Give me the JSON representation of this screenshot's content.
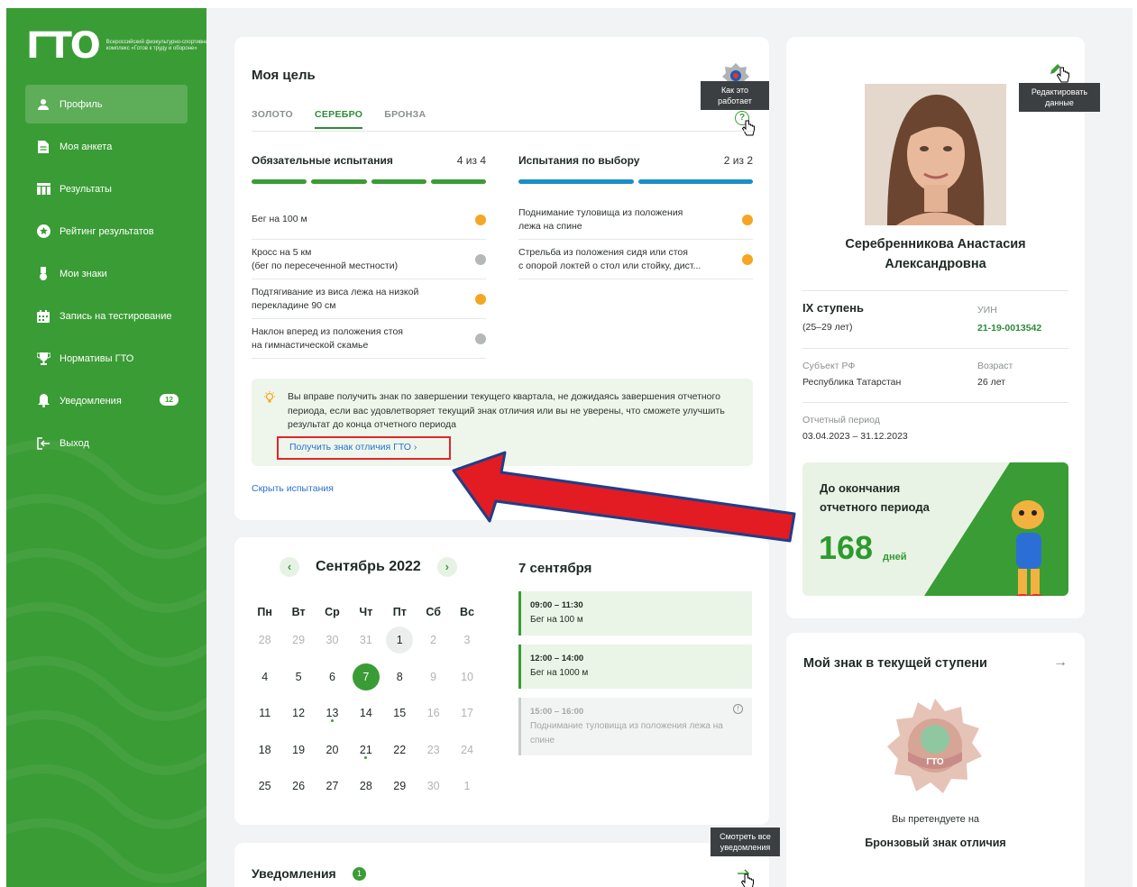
{
  "sidebar": {
    "logo_mark": "ГТО",
    "logo_text": "Всероссийский физкультурно-спортивный комплекс «Готов к труду и обороне»",
    "items": [
      {
        "label": "Профиль",
        "icon": "user-icon",
        "active": true
      },
      {
        "label": "Моя анкета",
        "icon": "document-icon"
      },
      {
        "label": "Результаты",
        "icon": "table-icon"
      },
      {
        "label": "Рейтинг результатов",
        "icon": "star-icon"
      },
      {
        "label": "Мои знаки",
        "icon": "medal-icon"
      },
      {
        "label": "Запись на тестирование",
        "icon": "calendar-icon"
      },
      {
        "label": "Нормативы ГТО",
        "icon": "trophy-icon"
      },
      {
        "label": "Уведомления",
        "icon": "bell-icon",
        "badge": "12"
      },
      {
        "label": "Выход",
        "icon": "logout-icon"
      }
    ]
  },
  "goal": {
    "title": "Моя цель",
    "tabs": [
      "ЗОЛОТО",
      "СЕРЕБРО",
      "БРОНЗА"
    ],
    "active_tab": "СЕРЕБРО",
    "help_tooltip": "Как это работает",
    "required": {
      "title": "Обязательные испытания",
      "count": "4 из 4",
      "tests": [
        {
          "name": "Бег на 100 м",
          "status": "orange"
        },
        {
          "name": "Кросс на 5 км",
          "name2": "(бег по пересеченной местности)",
          "status": "gray"
        },
        {
          "name": "Подтягивание из виса лежа на низкой",
          "name2": "перекладине 90 см",
          "status": "orange"
        },
        {
          "name": "Наклон вперед из положения стоя",
          "name2": "на гимнастической скамье",
          "status": "gray"
        }
      ]
    },
    "optional": {
      "title": "Испытания по выбору",
      "count": "2 из 2",
      "tests": [
        {
          "name": "Поднимание туловища из положения",
          "name2": "лежа на спине",
          "status": "orange"
        },
        {
          "name": "Стрельба из положения сидя или стоя",
          "name2": "с опорой локтей о стол или стойку, дист...",
          "status": "orange"
        }
      ]
    },
    "notice_text": "Вы вправе получить знак по завершении текущего квартала, не дожидаясь завершения отчетного периода, если вас  удовлетворяет текущий знак отличия или вы не уверены, что сможете улучшить результат до конца отчетного периода",
    "notice_link": "Получить знак отличия ГТО  ›",
    "hide_link": "Скрыть испытания"
  },
  "calendar": {
    "month": "Сентябрь 2022",
    "weekdays": [
      "Пн",
      "Вт",
      "Ср",
      "Чт",
      "Пт",
      "Сб",
      "Вс"
    ],
    "weeks": [
      [
        "28",
        "29",
        "30",
        "31",
        "1",
        "2",
        "3"
      ],
      [
        "4",
        "5",
        "6",
        "7",
        "8",
        "9",
        "10"
      ],
      [
        "11",
        "12",
        "13",
        "14",
        "15",
        "16",
        "17"
      ],
      [
        "18",
        "19",
        "20",
        "21",
        "22",
        "23",
        "24"
      ],
      [
        "25",
        "26",
        "27",
        "28",
        "29",
        "30",
        "1"
      ]
    ],
    "selected_day": "7",
    "day_title": "7 сентября",
    "slots": [
      {
        "time": "09:00 – 11:30",
        "name": "Бег на 100 м"
      },
      {
        "time": "12:00 – 14:00",
        "name": "Бег на 1000 м"
      },
      {
        "time": "15:00 – 16:00",
        "name": "Поднимание туловища из положения лежа на спине"
      }
    ]
  },
  "notifications": {
    "title": "Уведомления",
    "count": "1",
    "tooltip": "Смотреть все уведомления"
  },
  "profile": {
    "edit_tooltip": "Редактировать данные",
    "name": "Серебренникова Анастасия Александровна",
    "level": "IX ступень",
    "age_range": "(25–29 лет)",
    "uin_label": "УИН",
    "uin": "21-19-0013542",
    "region_label": "Субъект РФ",
    "region": "Республика Татарстан",
    "age_label": "Возраст",
    "age": "26 лет",
    "period_label": "Отчетный период",
    "period": "03.04.2023 – 31.12.2023",
    "countdown_label": "До окончания отчетного периода",
    "countdown_value": "168",
    "countdown_unit": "дней"
  },
  "badge": {
    "title": "Мой знак в текущей ступени",
    "claim_text": "Вы претендуете на",
    "badge_name": "Бронзовый знак отличия",
    "emblem_text": "ГТО"
  },
  "colors": {
    "brand_green": "#3a9c35",
    "orange": "#f5a623",
    "blue": "#1a8fc7",
    "highlight_red": "#e0262b"
  }
}
